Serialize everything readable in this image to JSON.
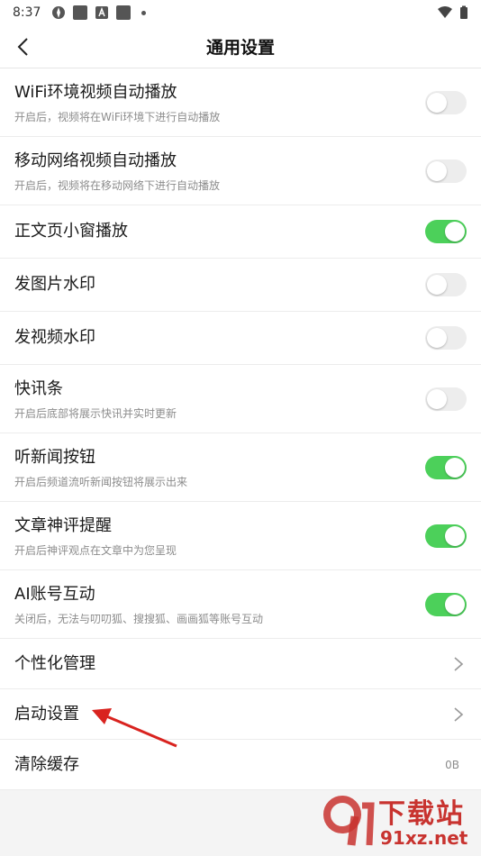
{
  "status_bar": {
    "time": "8:37"
  },
  "header": {
    "title": "通用设置"
  },
  "settings": [
    {
      "label": "WiFi环境视频自动播放",
      "desc": "开启后，视频将在WiFi环境下进行自动播放",
      "on": false
    },
    {
      "label": "移动网络视频自动播放",
      "desc": "开启后，视频将在移动网络下进行自动播放",
      "on": false
    },
    {
      "label": "正文页小窗播放",
      "on": true
    },
    {
      "label": "发图片水印",
      "on": false
    },
    {
      "label": "发视频水印",
      "on": false
    },
    {
      "label": "快讯条",
      "desc": "开启后底部将展示快讯并实时更新",
      "on": false
    },
    {
      "label": "听新闻按钮",
      "desc": "开启后频道流听新闻按钮将展示出来",
      "on": true
    },
    {
      "label": "文章神评提醒",
      "desc": "开启后神评观点在文章中为您呈现",
      "on": true
    },
    {
      "label": "AI账号互动",
      "desc": "关闭后，无法与叨叨狐、搜搜狐、画画狐等账号互动",
      "on": true
    }
  ],
  "nav_items": [
    {
      "label": "个性化管理"
    },
    {
      "label": "启动设置"
    },
    {
      "label": "清除缓存",
      "value": "0B"
    }
  ],
  "colors": {
    "toggle_on": "#4cd05a",
    "toggle_off": "#ededed",
    "annotation_arrow": "#d9231f",
    "watermark": "#c8332f"
  },
  "watermark": {
    "line1": "下载站",
    "line2": "91xz.net"
  }
}
